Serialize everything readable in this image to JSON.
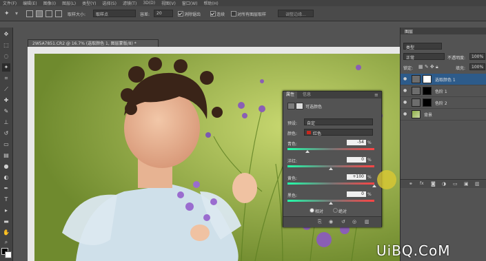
{
  "menubar": {
    "items": [
      "文件(F)",
      "编辑(E)",
      "图像(I)",
      "图层(L)",
      "类型(Y)",
      "选择(S)",
      "滤镜(T)",
      "3D(D)",
      "视图(V)",
      "窗口(W)",
      "帮助(H)"
    ]
  },
  "options": {
    "sample_size_label": "取样大小:",
    "sample_size_value": "取样点",
    "tolerance_label": "容差:",
    "tolerance_value": "20",
    "antialias_label": "消除锯齿",
    "contiguous_label": "连续",
    "all_layers_label": "对所有图层取样",
    "refine_edge_label": "调整边缘..."
  },
  "document": {
    "tab_title": "2W5A7851.CR2 @ 16.7% (选取颜色 1, 图层蒙版/8) *"
  },
  "properties": {
    "tab_properties": "属性",
    "tab_info": "信息",
    "title": "可选颜色",
    "preset_label": "预设:",
    "preset_value": "自定",
    "color_label": "颜色:",
    "color_value": "红色",
    "sliders": [
      {
        "label": "青色:",
        "value": "-54",
        "unit": "%",
        "fraction": 0.23
      },
      {
        "label": "洋红:",
        "value": "0",
        "unit": "%",
        "fraction": 0.5
      },
      {
        "label": "黄色:",
        "value": "+100",
        "unit": "%",
        "fraction": 1.0
      },
      {
        "label": "黑色:",
        "value": "0",
        "unit": "%",
        "fraction": 0.5
      }
    ],
    "relative_label": "相对",
    "absolute_label": "绝对"
  },
  "layers": {
    "panel_title": "图层",
    "filter_value": "类型",
    "blend_mode": "正常",
    "opacity_label": "不透明度:",
    "opacity_value": "100%",
    "lock_label": "锁定:",
    "fill_label": "填充:",
    "fill_value": "100%",
    "items": [
      {
        "name": "选取颜色 1",
        "active": true
      },
      {
        "name": "色阶 1",
        "active": false
      },
      {
        "name": "色阶 2",
        "active": false
      },
      {
        "name": "背景",
        "active": false
      }
    ]
  },
  "watermark": {
    "text": "UiBQ.CoM"
  },
  "colors": {
    "accent_red": "#c8281e",
    "panel": "#535353",
    "selected_row": "#2d5b8a"
  }
}
